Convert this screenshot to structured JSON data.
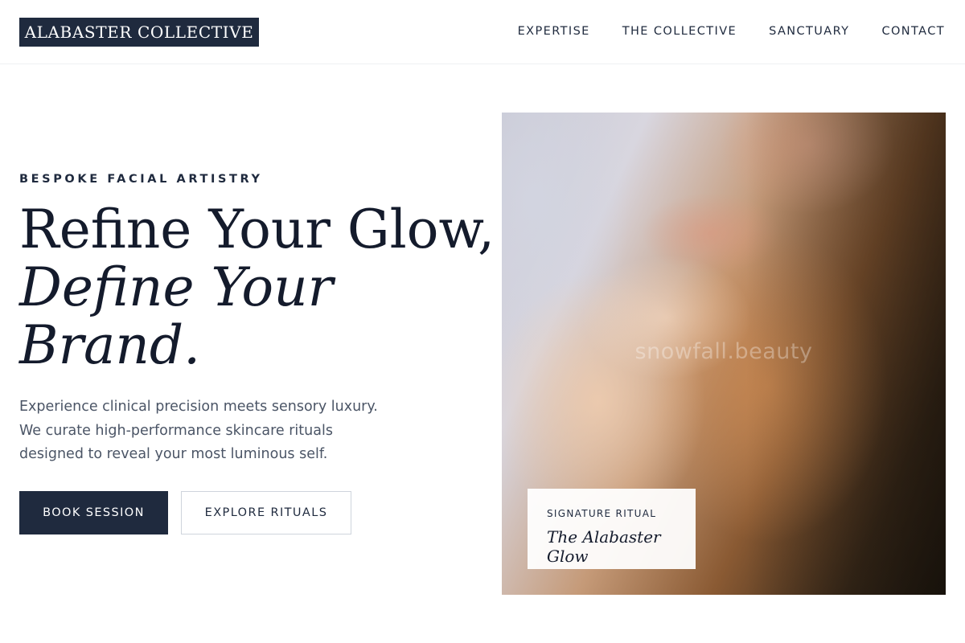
{
  "header": {
    "brand": "ALABASTER COLLECTIVE",
    "nav": [
      "EXPERTISE",
      "THE COLLECTIVE",
      "SANCTUARY",
      "CONTACT"
    ]
  },
  "hero": {
    "eyebrow": "BESPOKE FACIAL ARTISTRY",
    "headline_line1": "Refine Your Glow,",
    "headline_line2": "Define Your",
    "headline_line3": "Brand.",
    "lede": "Experience clinical precision meets sensory luxury. We curate high-performance skincare rituals designed to reveal your most luminous self.",
    "primary_cta": "BOOK SESSION",
    "secondary_cta": "EXPLORE RITUALS"
  },
  "feature_image": {
    "watermark": "snowfall.beauty",
    "caption_eyebrow": "SIGNATURE RITUAL",
    "caption_title": "The Alabaster Glow"
  },
  "colors": {
    "navy": "#1f2a3e",
    "ink": "#141b2c",
    "body_text": "#4b5566",
    "border": "#cfd4dc"
  }
}
